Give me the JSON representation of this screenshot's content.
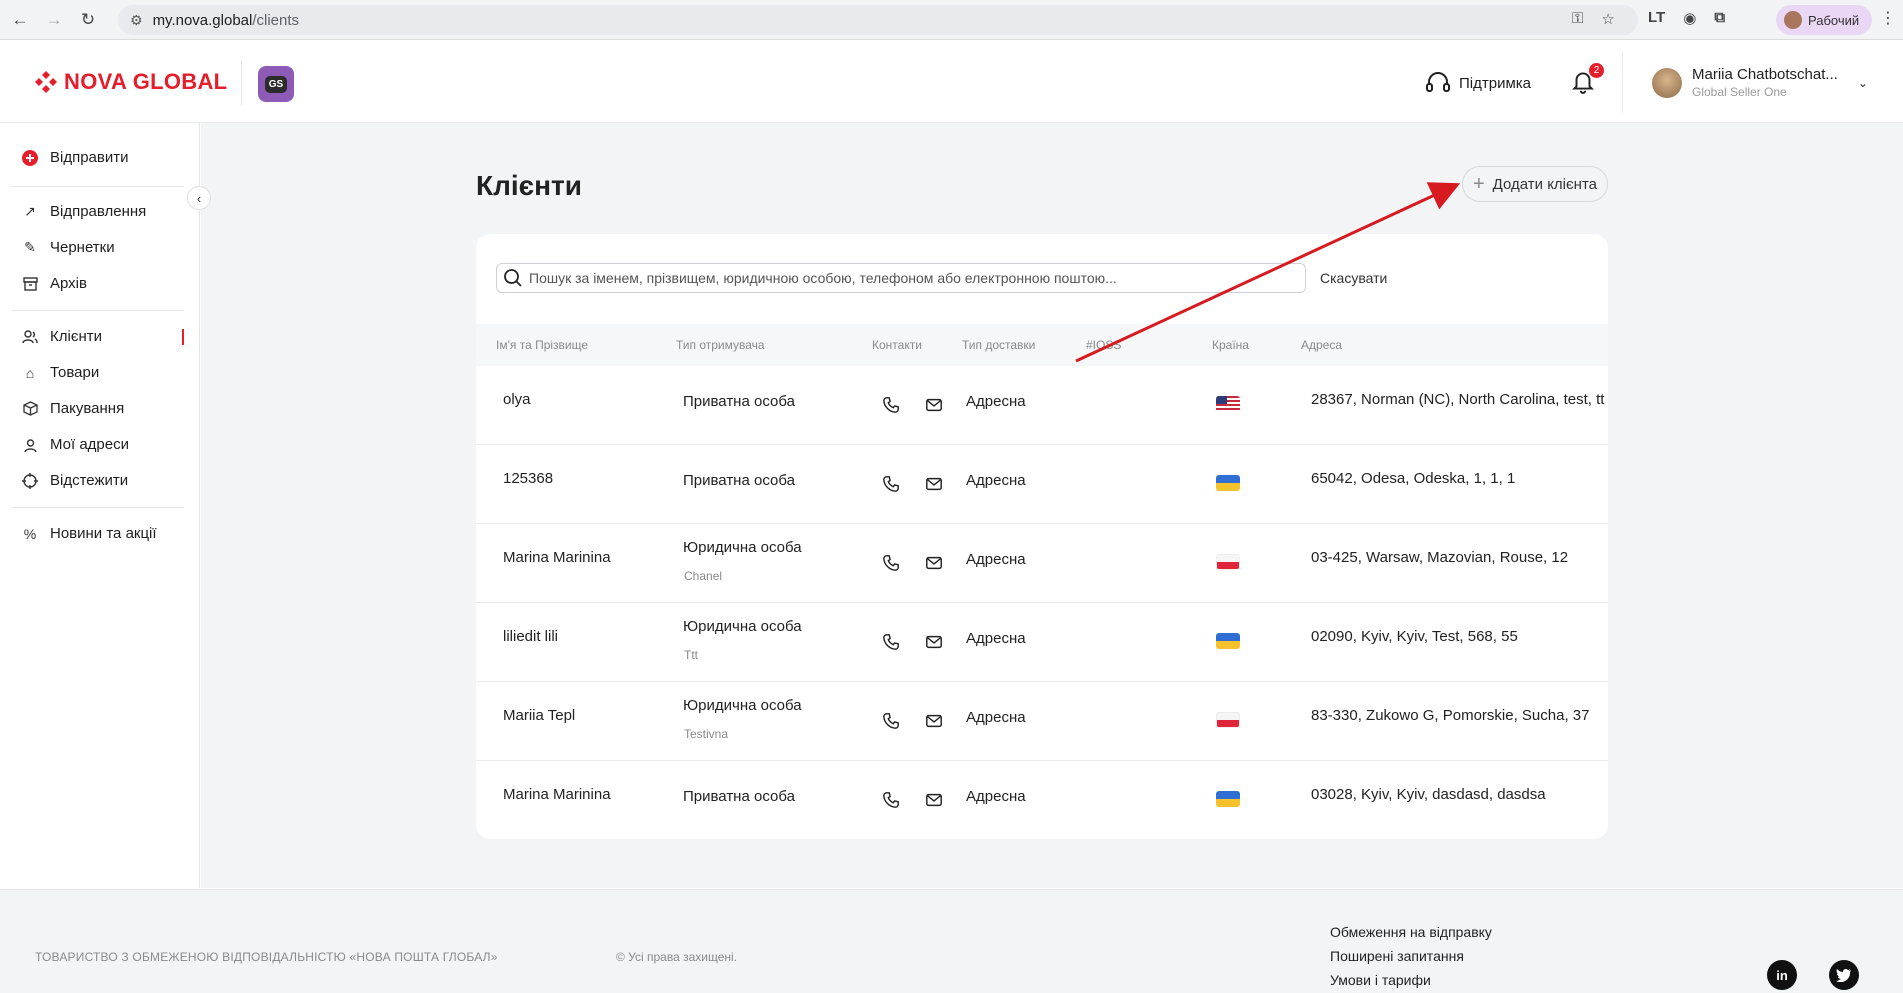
{
  "browser": {
    "url_host": "my.nova.global",
    "url_path": "/clients",
    "profile_label": "Рабочий"
  },
  "header": {
    "brand_text": "NOVA GLOBAL",
    "badge_text": "GS",
    "support_label": "Підтримка",
    "notifications_count": "2",
    "user_name": "Mariia Chatbotschat...",
    "user_role": "Global Seller One"
  },
  "sidebar": {
    "send_label": "Відправити",
    "items": [
      {
        "label": "Відправлення",
        "icon": "arrow-up-right-icon"
      },
      {
        "label": "Чернетки",
        "icon": "edit-icon"
      },
      {
        "label": "Архів",
        "icon": "archive-icon"
      },
      {
        "label": "Клієнти",
        "icon": "users-icon"
      },
      {
        "label": "Товари",
        "icon": "tag-icon"
      },
      {
        "label": "Пакування",
        "icon": "box-icon"
      },
      {
        "label": "Мої адреси",
        "icon": "location-icon"
      },
      {
        "label": "Відстежити",
        "icon": "crosshair-icon"
      },
      {
        "label": "Новини та акції",
        "icon": "percent-icon"
      }
    ]
  },
  "page": {
    "title": "Клієнти",
    "add_button": "Додати клієнта",
    "search_placeholder": "Пошук за іменем, прізвищем, юридичною особою, телефоном або електронною поштою...",
    "cancel_label": "Скасувати"
  },
  "table": {
    "columns": [
      "Ім'я та Прізвище",
      "Тип отримувача",
      "Контакти",
      "Тип доставки",
      "#IOSS",
      "Країна",
      "Адреса"
    ],
    "rows": [
      {
        "name": "olya",
        "type": "Приватна особа",
        "company": "",
        "delivery": "Адресна",
        "country": "us",
        "address": "28367, Norman (NC), North Carolina, test, tt"
      },
      {
        "name": "125368",
        "type": "Приватна особа",
        "company": "",
        "delivery": "Адресна",
        "country": "ua",
        "address": "65042, Odesa, Odeska, 1, 1, 1"
      },
      {
        "name": "Marina Marinina",
        "type": "Юридична особа",
        "company": "Chanel",
        "delivery": "Адресна",
        "country": "pl",
        "address": "03-425, Warsaw, Mazovian, Rouse, 12"
      },
      {
        "name": "liliedit lili",
        "type": "Юридична особа",
        "company": "Ttt",
        "delivery": "Адресна",
        "country": "ua",
        "address": "02090, Kyiv, Kyiv, Test, 568, 55"
      },
      {
        "name": "Mariia Tepl",
        "type": "Юридична особа",
        "company": "Testivna",
        "delivery": "Адресна",
        "country": "pl",
        "address": "83-330, Zukowo G, Pomorskie, Sucha, 37"
      },
      {
        "name": "Marina Marinina",
        "type": "Приватна особа",
        "company": "",
        "delivery": "Адресна",
        "country": "ua",
        "address": "03028, Kyiv, Kyiv, dasdasd, dasdsa"
      }
    ]
  },
  "footer": {
    "company": "ТОВАРИСТВО З ОБМЕЖЕНОЮ ВІДПОВІДАЛЬНІСТЮ «НОВА ПОШТА ГЛОБАЛ»",
    "rights": "© Усі права захищені.",
    "links": [
      "Обмеження на відправку",
      "Поширені запитання",
      "Умови і тарифи"
    ]
  },
  "colors": {
    "brand": "#e41e2b",
    "annotation_arrow": "#d71920"
  }
}
